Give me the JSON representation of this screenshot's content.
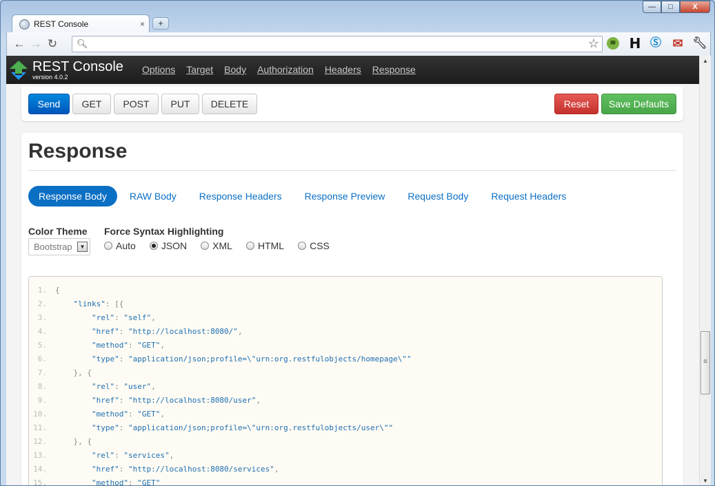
{
  "browser": {
    "tab_title": "REST Console",
    "tab_close": "×",
    "new_tab": "+",
    "url": "",
    "window_controls": {
      "minimize": "—",
      "maximize": "□",
      "close": "X"
    },
    "icons": [
      "back-icon",
      "forward-icon",
      "reload-icon",
      "search-icon",
      "star-icon",
      "spotify-icon",
      "h-icon",
      "skype-icon",
      "gmail-icon",
      "wrench-icon"
    ],
    "extensions": {
      "h_label": "H"
    }
  },
  "app": {
    "name": "REST Console",
    "version": "version 4.0.2",
    "menu": [
      "Options",
      "Target",
      "Body",
      "Authorization",
      "Headers",
      "Response"
    ]
  },
  "actions": {
    "send": "Send",
    "get": "GET",
    "post": "POST",
    "put": "PUT",
    "delete": "DELETE",
    "reset": "Reset",
    "save_defaults": "Save Defaults"
  },
  "response": {
    "title": "Response",
    "tabs": [
      "Response Body",
      "RAW Body",
      "Response Headers",
      "Response Preview",
      "Request Body",
      "Request Headers"
    ],
    "active_tab": "Response Body",
    "color_theme_label": "Color Theme",
    "color_theme_value": "Bootstrap",
    "syntax_label": "Force Syntax Highlighting",
    "syntax_options": [
      "Auto",
      "JSON",
      "XML",
      "HTML",
      "CSS"
    ],
    "syntax_selected": "JSON"
  },
  "code_lines": [
    {
      "n": "1",
      "indent": "",
      "parts": [
        [
          "p",
          "{"
        ]
      ]
    },
    {
      "n": "2",
      "indent": "    ",
      "parts": [
        [
          "k",
          "\"links\""
        ],
        [
          "p",
          ": [{"
        ]
      ]
    },
    {
      "n": "3",
      "indent": "        ",
      "parts": [
        [
          "k",
          "\"rel\""
        ],
        [
          "p",
          ": "
        ],
        [
          "s",
          "\"self\""
        ],
        [
          "p",
          ","
        ]
      ]
    },
    {
      "n": "4",
      "indent": "        ",
      "parts": [
        [
          "k",
          "\"href\""
        ],
        [
          "p",
          ": "
        ],
        [
          "s",
          "\"http://localhost:8080/\""
        ],
        [
          "p",
          ","
        ]
      ]
    },
    {
      "n": "5",
      "indent": "        ",
      "parts": [
        [
          "k",
          "\"method\""
        ],
        [
          "p",
          ": "
        ],
        [
          "s",
          "\"GET\""
        ],
        [
          "p",
          ","
        ]
      ]
    },
    {
      "n": "6",
      "indent": "        ",
      "parts": [
        [
          "k",
          "\"type\""
        ],
        [
          "p",
          ": "
        ],
        [
          "s",
          "\"application/json;profile=\\\"urn:org.restfulobjects/homepage\\\"\""
        ]
      ]
    },
    {
      "n": "7",
      "indent": "    ",
      "parts": [
        [
          "p",
          "}, {"
        ]
      ]
    },
    {
      "n": "8",
      "indent": "        ",
      "parts": [
        [
          "k",
          "\"rel\""
        ],
        [
          "p",
          ": "
        ],
        [
          "s",
          "\"user\""
        ],
        [
          "p",
          ","
        ]
      ]
    },
    {
      "n": "9",
      "indent": "        ",
      "parts": [
        [
          "k",
          "\"href\""
        ],
        [
          "p",
          ": "
        ],
        [
          "s",
          "\"http://localhost:8080/user\""
        ],
        [
          "p",
          ","
        ]
      ]
    },
    {
      "n": "10",
      "indent": "        ",
      "parts": [
        [
          "k",
          "\"method\""
        ],
        [
          "p",
          ": "
        ],
        [
          "s",
          "\"GET\""
        ],
        [
          "p",
          ","
        ]
      ]
    },
    {
      "n": "11",
      "indent": "        ",
      "parts": [
        [
          "k",
          "\"type\""
        ],
        [
          "p",
          ": "
        ],
        [
          "s",
          "\"application/json;profile=\\\"urn:org.restfulobjects/user\\\"\""
        ]
      ]
    },
    {
      "n": "12",
      "indent": "    ",
      "parts": [
        [
          "p",
          "}, {"
        ]
      ]
    },
    {
      "n": "13",
      "indent": "        ",
      "parts": [
        [
          "k",
          "\"rel\""
        ],
        [
          "p",
          ": "
        ],
        [
          "s",
          "\"services\""
        ],
        [
          "p",
          ","
        ]
      ]
    },
    {
      "n": "14",
      "indent": "        ",
      "parts": [
        [
          "k",
          "\"href\""
        ],
        [
          "p",
          ": "
        ],
        [
          "s",
          "\"http://localhost:8080/services\""
        ],
        [
          "p",
          ","
        ]
      ]
    },
    {
      "n": "15",
      "indent": "        ",
      "parts": [
        [
          "k",
          "\"method\""
        ],
        [
          "p",
          ": "
        ],
        [
          "s",
          "\"GET\""
        ]
      ]
    }
  ],
  "colors": {
    "primary": "#0b6fc4",
    "danger": "#d9433e",
    "success": "#52b152",
    "appbar": "#222222",
    "code_bg": "#fdfbf3"
  }
}
